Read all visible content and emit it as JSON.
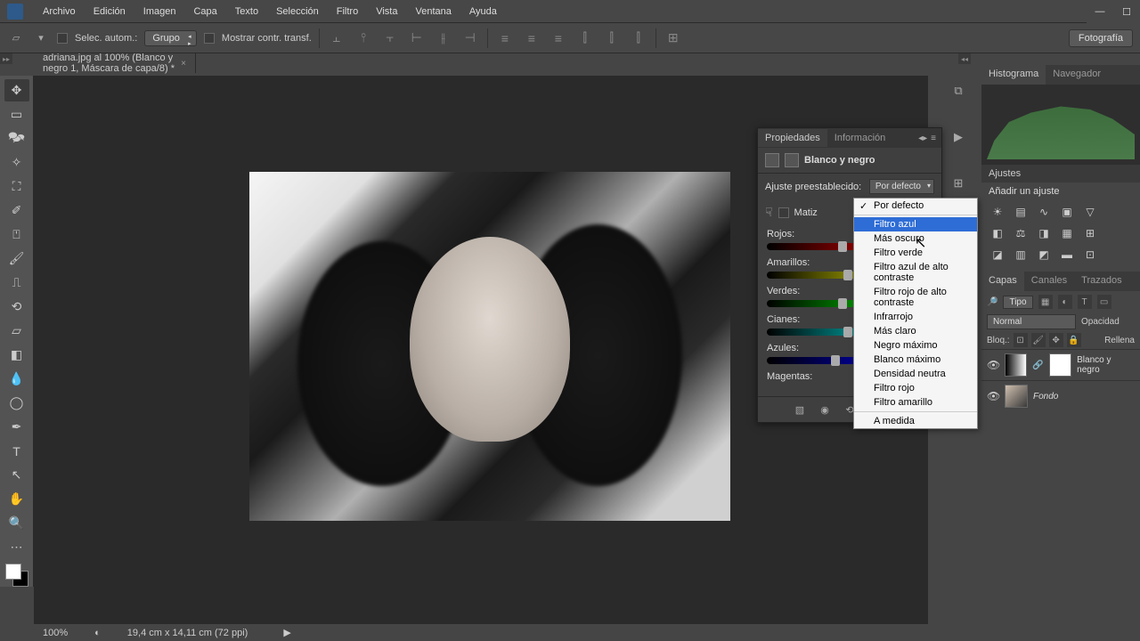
{
  "menu": {
    "items": [
      "Archivo",
      "Edición",
      "Imagen",
      "Capa",
      "Texto",
      "Selección",
      "Filtro",
      "Vista",
      "Ventana",
      "Ayuda"
    ]
  },
  "optionsbar": {
    "auto_select": "Selec. autom.:",
    "group_select": "Grupo",
    "show_transform": "Mostrar contr. transf.",
    "workspace_chip": "Fotografía"
  },
  "document": {
    "tab_title": "adriana.jpg al 100% (Blanco y negro 1, Máscara de capa/8) *"
  },
  "statusbar": {
    "zoom": "100%",
    "dims": "19,4 cm x 14,11 cm (72 ppi)"
  },
  "right_panels": {
    "histogram_tab": "Histograma",
    "navigator_tab": "Navegador",
    "adjustments_head": "Ajustes",
    "adjustments_sub": "Añadir un ajuste"
  },
  "layers": {
    "tabs": [
      "Capas",
      "Canales",
      "Trazados"
    ],
    "kind_label": "Tipo",
    "blend_mode": "Normal",
    "opacity_label": "Opacidad",
    "lock_label": "Bloq.:",
    "fill_label": "Rellena",
    "rows": [
      {
        "name": "Blanco y negro"
      },
      {
        "name": "Fondo"
      }
    ]
  },
  "properties": {
    "tab_props": "Propiedades",
    "tab_info": "Información",
    "title": "Blanco y negro",
    "preset_label": "Ajuste preestablecido:",
    "preset_value": "Por defecto",
    "tint_label": "Matiz",
    "sliders": [
      "Rojos:",
      "Amarillos:",
      "Verdes:",
      "Cianes:",
      "Azules:",
      "Magentas:"
    ]
  },
  "dropdown": {
    "items": [
      "Por defecto",
      "Filtro azul",
      "Más oscuro",
      "Filtro verde",
      "Filtro azul de alto contraste",
      "Filtro rojo de alto contraste",
      "Infrarrojo",
      "Más claro",
      "Negro máximo",
      "Blanco máximo",
      "Densidad neutra",
      "Filtro rojo",
      "Filtro amarillo",
      "A medida"
    ],
    "checked_index": 0,
    "highlight_index": 1
  }
}
